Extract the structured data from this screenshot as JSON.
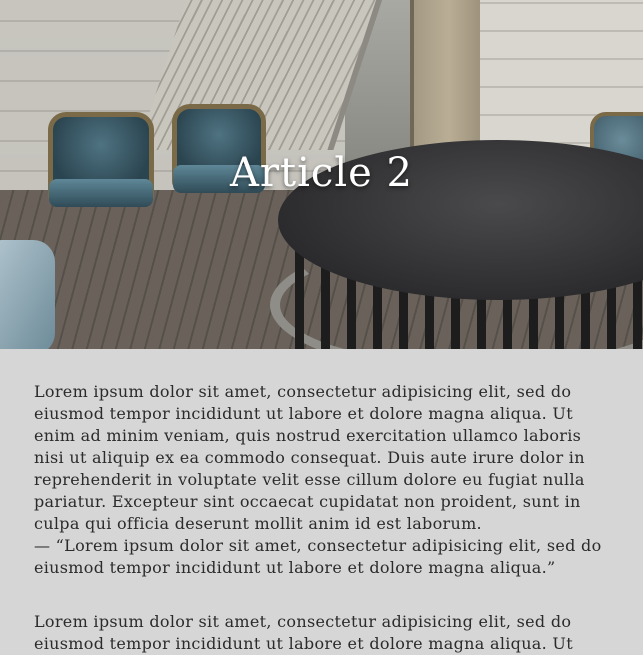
{
  "hero": {
    "title": "Article 2"
  },
  "article": {
    "paragraph_1": "Lorem ipsum dolor sit amet, consectetur adipisicing elit, sed do eiusmod tempor incididunt ut labore et dolore magna aliqua. Ut enim ad minim veniam, quis nostrud exercitation ullamco laboris nisi ut aliquip ex ea commodo consequat. Duis aute irure dolor in reprehenderit in voluptate velit esse cillum dolore eu fugiat nulla pariatur. Excepteur sint occaecat cupidatat non proident, sunt in culpa qui officia deserunt mollit anim id est laborum.",
    "quote": "— “Lorem ipsum dolor sit amet, consectetur adipisicing elit, sed do eiusmod tempor incididunt ut labore et dolore magna aliqua.”",
    "paragraph_2": "Lorem ipsum dolor sit amet, consectetur adipisicing elit, sed do eiusmod tempor incididunt ut labore et dolore magna aliqua. Ut"
  },
  "colors": {
    "page_background": "#d6d6d6",
    "text": "#2b2b2b",
    "title": "#ffffff"
  }
}
